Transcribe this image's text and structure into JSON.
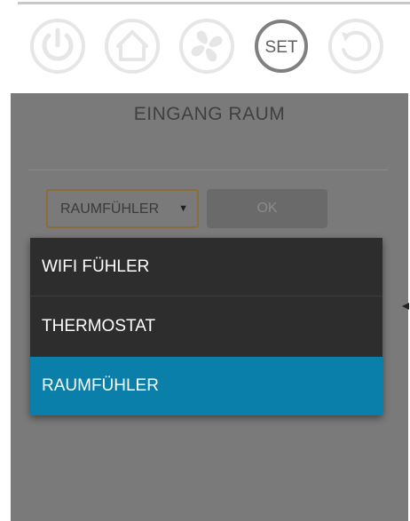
{
  "toolbar": {
    "set_label": "SET"
  },
  "panel": {
    "title": "EINGANG RAUM",
    "select_value": "RAUMFÜHLER",
    "select_arrow": "▼",
    "ok_label": "OK"
  },
  "dropdown": {
    "options": [
      {
        "label": "WIFI FÜHLER"
      },
      {
        "label": "THERMOSTAT"
      },
      {
        "label": "RAUMFÜHLER"
      }
    ],
    "selected_index": 2
  },
  "colors": {
    "panel_bg": "#7a7a7a",
    "dropdown_bg": "#2d2d2d",
    "selected_bg": "#0a7fa9",
    "icon_inactive": "#e6e6e6",
    "icon_active": "#808080"
  },
  "icons": [
    "power-icon",
    "home-icon",
    "fan-icon",
    "set-icon",
    "reset-icon"
  ]
}
